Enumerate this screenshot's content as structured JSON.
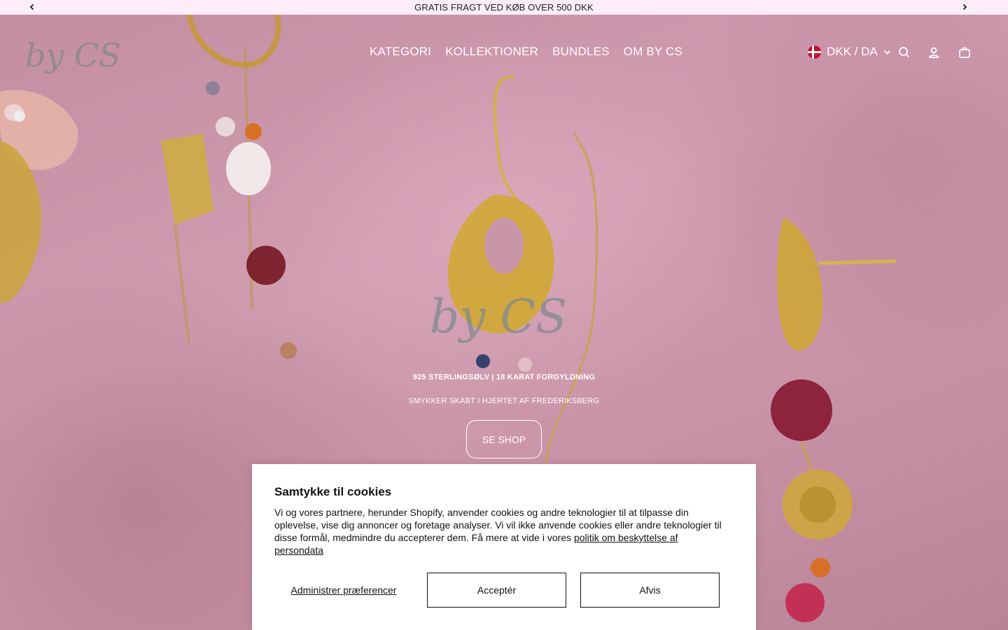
{
  "announcement": {
    "text": "GRATIS FRAGT VED KØB OVER 500 DKK",
    "prev_icon": "chevron-left-icon",
    "next_icon": "chevron-right-icon"
  },
  "header": {
    "logo_text": "by CS",
    "nav": [
      {
        "label": "KATEGORI"
      },
      {
        "label": "KOLLEKTIONER"
      },
      {
        "label": "BUNDLES"
      },
      {
        "label": "OM BY CS"
      }
    ],
    "locale": {
      "label": "DKK / DA",
      "flag": "denmark-flag-icon"
    },
    "icons": [
      "search-icon",
      "account-icon",
      "cart-icon"
    ]
  },
  "hero": {
    "logo_text": "by CS",
    "tagline_primary": "925 STERLINGSØLV | 18 KARAT FORGYLDNING",
    "tagline_secondary": "SMYKKER SKABT I HJERTET AF FREDERIKSBERG",
    "cta_label": "SE SHOP"
  },
  "cookie_banner": {
    "title": "Samtykke til cookies",
    "body": "Vi og vores partnere, herunder Shopify, anvender cookies og andre teknologier til at tilpasse din oplevelse, vise dig annoncer og foretage analyser. Vi vil ikke anvende cookies eller andre teknologier til disse formål, medmindre du accepterer dem. Få mere at vide i vores ",
    "privacy_link": "politik om beskyttelse af persondata",
    "manage_label": "Administrer præferencer",
    "accept_label": "Acceptér",
    "decline_label": "Afvis"
  },
  "colors": {
    "announcement_bg": "#fbeef6",
    "hero_bg": "#c996a8",
    "text_light": "#ffffff",
    "logo_gray": "#8a8a8a"
  }
}
